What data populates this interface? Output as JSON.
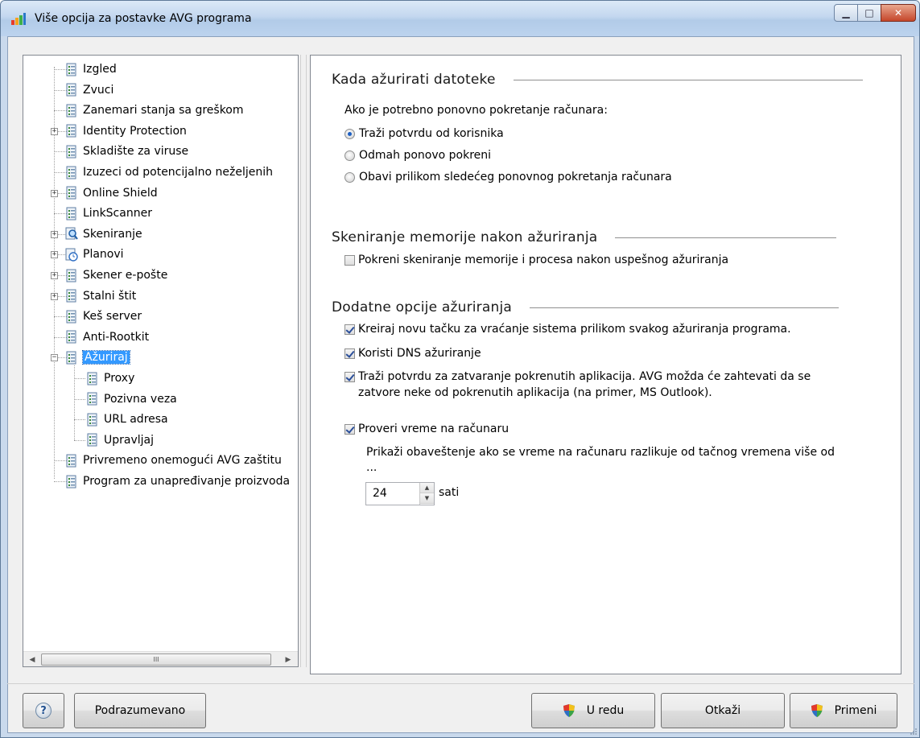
{
  "window": {
    "title": "Više opcija za postavke AVG programa"
  },
  "tree": {
    "items": [
      {
        "label": "Izgled",
        "icon": "settings-page-icon",
        "expander": ""
      },
      {
        "label": "Zvuci",
        "icon": "settings-page-icon",
        "expander": ""
      },
      {
        "label": "Zanemari stanja sa greškom",
        "icon": "settings-page-icon",
        "expander": ""
      },
      {
        "label": "Identity Protection",
        "icon": "settings-page-icon",
        "expander": "+"
      },
      {
        "label": "Skladište za viruse",
        "icon": "settings-page-icon",
        "expander": ""
      },
      {
        "label": "Izuzeci od potencijalno neželjenih",
        "icon": "settings-page-icon",
        "expander": ""
      },
      {
        "label": "Online Shield",
        "icon": "settings-page-icon",
        "expander": "+"
      },
      {
        "label": "LinkScanner",
        "icon": "settings-page-icon",
        "expander": ""
      },
      {
        "label": "Skeniranje",
        "icon": "scan-magnifier-icon",
        "expander": "+"
      },
      {
        "label": "Planovi",
        "icon": "schedule-icon",
        "expander": "+"
      },
      {
        "label": "Skener e-pošte",
        "icon": "settings-page-icon",
        "expander": "+"
      },
      {
        "label": "Stalni štit",
        "icon": "settings-page-icon",
        "expander": "+"
      },
      {
        "label": "Keš server",
        "icon": "settings-page-icon",
        "expander": ""
      },
      {
        "label": "Anti-Rootkit",
        "icon": "settings-page-icon",
        "expander": ""
      },
      {
        "label": "Ažuriraj",
        "icon": "settings-page-icon",
        "expander": "−",
        "selected": true
      },
      {
        "label": "Proxy",
        "icon": "settings-page-icon",
        "expander": "",
        "child": true
      },
      {
        "label": "Pozivna veza",
        "icon": "settings-page-icon",
        "expander": "",
        "child": true
      },
      {
        "label": "URL adresa",
        "icon": "settings-page-icon",
        "expander": "",
        "child": true
      },
      {
        "label": "Upravljaj",
        "icon": "settings-page-icon",
        "expander": "",
        "child": true
      },
      {
        "label": "Privremeno onemogući AVG zaštitu",
        "icon": "settings-page-icon",
        "expander": ""
      },
      {
        "label": "Program za unapređivanje proizvoda",
        "icon": "settings-page-icon",
        "expander": ""
      }
    ],
    "hscroll_thumb_glyph": "III"
  },
  "update_when": {
    "title": "Kada ažurirati datoteke",
    "restart_prompt": "Ako je potrebno ponovno pokretanje računara:",
    "options": [
      {
        "label": "Traži potvrdu od korisnika",
        "checked": true
      },
      {
        "label": "Odmah ponovo pokreni",
        "checked": false
      },
      {
        "label": "Obavi prilikom sledećeg ponovnog pokretanja računara",
        "checked": false
      }
    ]
  },
  "memory_scan": {
    "title": "Skeniranje memorije nakon ažuriranja",
    "option": {
      "label": "Pokreni skeniranje memorije i procesa nakon uspešnog ažuriranja",
      "checked": false
    }
  },
  "additional": {
    "title": "Dodatne opcije ažuriranja",
    "restore_point": {
      "label": "Kreiraj novu tačku za vraćanje sistema prilikom svakog ažuriranja programa.",
      "checked": true
    },
    "dns_update": {
      "label": "Koristi DNS ažuriranje",
      "checked": true
    },
    "close_apps": {
      "label_line1": "Traži potvrdu za zatvaranje pokrenutih aplikacija. AVG možda će zahtevati da se",
      "label_line2": "zatvore neke od pokrenutih aplikacija (na primer, MS Outlook).",
      "checked": true
    },
    "check_time": {
      "label": "Proveri vreme na računaru",
      "checked": true
    },
    "time_notice_line1": "Prikaži obaveštenje ako se vreme na računaru razlikuje od tačnog vremena više od",
    "time_notice_line2": "...",
    "hours_value": "24",
    "hours_unit": "sati"
  },
  "buttons": {
    "help": "?",
    "default": "Podrazumevano",
    "ok": "U redu",
    "cancel": "Otkaži",
    "apply": "Primeni"
  },
  "colors": {
    "selection": "#3399ff",
    "titlebar": "#c3d7ef",
    "close_button": "#c5462a"
  }
}
